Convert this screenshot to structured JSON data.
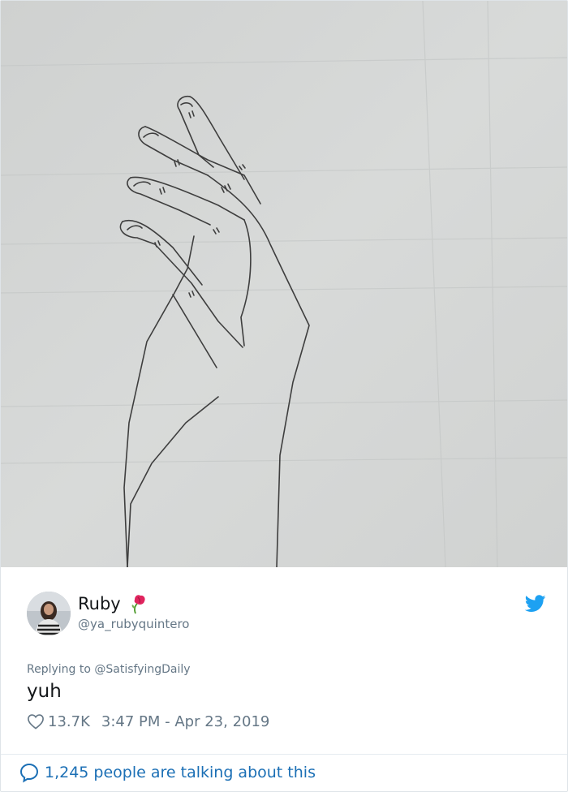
{
  "tweet": {
    "author": {
      "display_name": "Ruby",
      "handle": "@ya_rubyquintero",
      "emoji_icon": "wilted-rose-icon"
    },
    "replying_to": "Replying to @SatisfyingDaily",
    "text": "yuh",
    "likes": "13.7K",
    "timestamp": "3:47 PM - Apr 23, 2019",
    "conversation_label": "1,245 people are talking about this",
    "brand_icon": "twitter-bird-icon"
  },
  "colors": {
    "twitter_blue": "#1da1f2",
    "link_blue": "#1b6fb5",
    "secondary_text": "#657786",
    "primary_text": "#14171a"
  }
}
